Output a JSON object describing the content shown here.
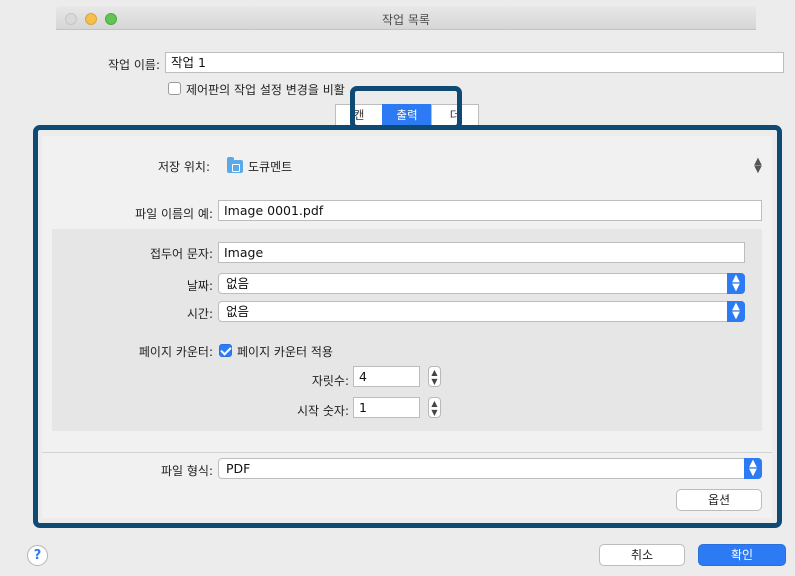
{
  "window": {
    "title": "작업 목록"
  },
  "job": {
    "name_label": "작업 이름:",
    "name_value": "작업 1",
    "allow_change_label": "제어판의 작업 설정 변경을 비활"
  },
  "tabs": [
    {
      "label": "캔"
    },
    {
      "label": "출력"
    },
    {
      "label": "더"
    }
  ],
  "output": {
    "save_location_label": "저장 위치:",
    "save_location_value": "도큐멘트",
    "filename_example_label": "파일 이름의 예:",
    "filename_example_value": "Image 0001.pdf",
    "prefix_label": "접두어 문자:",
    "prefix_value": "Image",
    "date_label": "날짜:",
    "date_value": "없음",
    "time_label": "시간:",
    "time_value": "없음",
    "page_counter_label": "페이지 카운터:",
    "page_counter_checkbox_label": "페이지 카운터 적용",
    "page_counter_checked": true,
    "digits_label": "자릿수:",
    "digits_value": "4",
    "start_number_label": "시작 숫자:",
    "start_number_value": "1",
    "file_format_label": "파일 형식:",
    "file_format_value": "PDF",
    "options_button": "옵션"
  },
  "footer": {
    "help": "?",
    "cancel_button": "취소",
    "ok_button": "확인"
  },
  "colors": {
    "accent": "#2d7bf4",
    "highlight_border": "#0f4a75",
    "window_bg": "#ececec"
  },
  "icons": [
    "folder-icon",
    "chevron-updown-icon",
    "help-icon"
  ]
}
